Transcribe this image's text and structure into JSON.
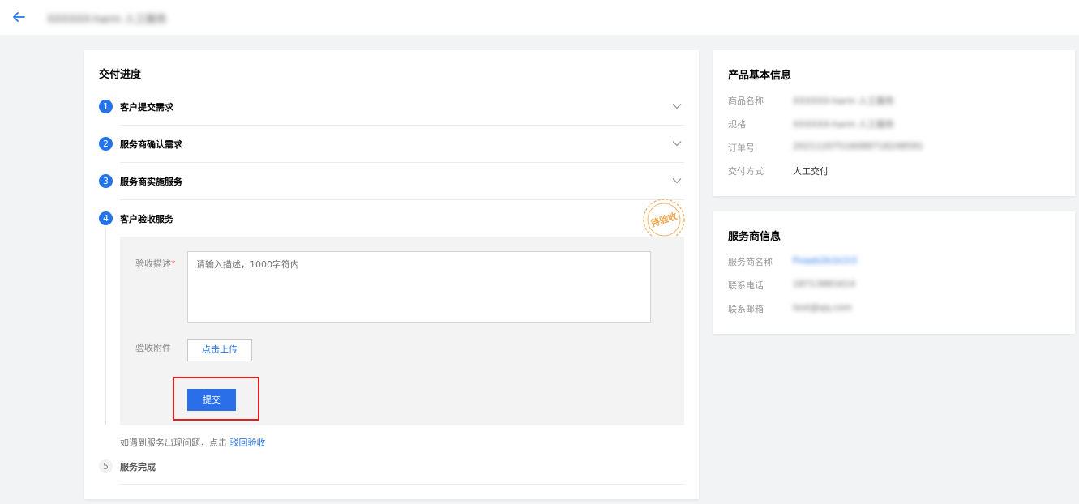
{
  "header": {
    "back_icon": "arrow-left-icon",
    "title": "XXXXXX-harm 人工服务"
  },
  "progress": {
    "title": "交付进度",
    "steps": [
      {
        "num": "1",
        "label": "客户提交需求",
        "state": "done"
      },
      {
        "num": "2",
        "label": "服务商确认需求",
        "state": "done"
      },
      {
        "num": "3",
        "label": "服务商实施服务",
        "state": "done"
      },
      {
        "num": "4",
        "label": "客户验收服务",
        "state": "active"
      },
      {
        "num": "5",
        "label": "服务完成",
        "state": "pending"
      }
    ],
    "stamp_text": "待验收",
    "form": {
      "desc_label": "验收描述",
      "desc_required_mark": "*",
      "desc_placeholder": "请输入描述，1000字符内",
      "attach_label": "验收附件",
      "upload_label": "点击上传",
      "submit_label": "提交"
    },
    "help_text": "如遇到服务出现问题，点击",
    "help_link": "驳回验收"
  },
  "product": {
    "title": "产品基本信息",
    "rows": [
      {
        "key": "商品名称",
        "value": "XXXXXX-harm 人工服务"
      },
      {
        "key": "规格",
        "value": "XXXXXX-harm 人工服务"
      },
      {
        "key": "订单号",
        "value": "20211207516088718248591"
      },
      {
        "key": "交付方式",
        "value": "人工交付"
      }
    ]
  },
  "provider": {
    "title": "服务商信息",
    "rows": [
      {
        "key": "服务商名称",
        "value": "Pxaab2b1k1t3"
      },
      {
        "key": "联系电话",
        "value": "18713881614"
      },
      {
        "key": "联系邮箱",
        "value": "test@qq.com"
      }
    ]
  },
  "colors": {
    "accent": "#2473e8",
    "highlight": "#e01e1e",
    "stamp": "#f0a44a"
  }
}
